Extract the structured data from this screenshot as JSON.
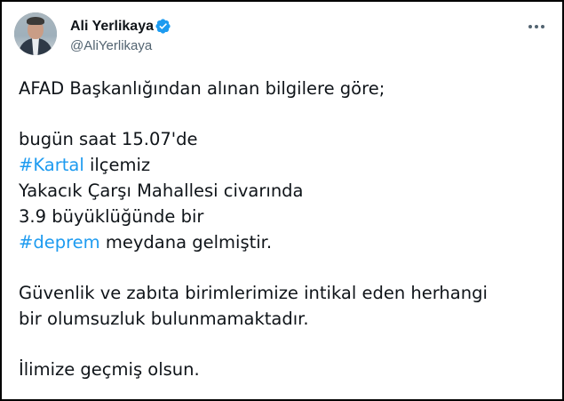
{
  "author": {
    "display_name": "Ali Yerlikaya",
    "handle": "@AliYerlikaya",
    "verified": true,
    "avatar_icon": "profile-photo"
  },
  "menu": {
    "icon": "more-horizontal-icon"
  },
  "tweet": {
    "line1": "AFAD Başkanlığından alınan bilgilere göre;",
    "line2": "bugün saat 15.07'de",
    "line3_hashtag": "#Kartal",
    "line3_rest": " ilçemiz",
    "line4": "Yakacık Çarşı Mahallesi civarında",
    "line5": "3.9 büyüklüğünde bir",
    "line6_hashtag": "#deprem",
    "line6_rest": " meydana gelmiştir.",
    "line7": "Güvenlik ve zabıta birimlerimize intikal eden herhangi",
    "line8": "bir olumsuzluk bulunmamaktadır.",
    "line9": "İlimize geçmiş olsun."
  },
  "colors": {
    "text": "#0f1419",
    "secondary": "#536471",
    "hashtag": "#1d9bf0",
    "verified": "#1d9bf0",
    "border": "#000000"
  }
}
